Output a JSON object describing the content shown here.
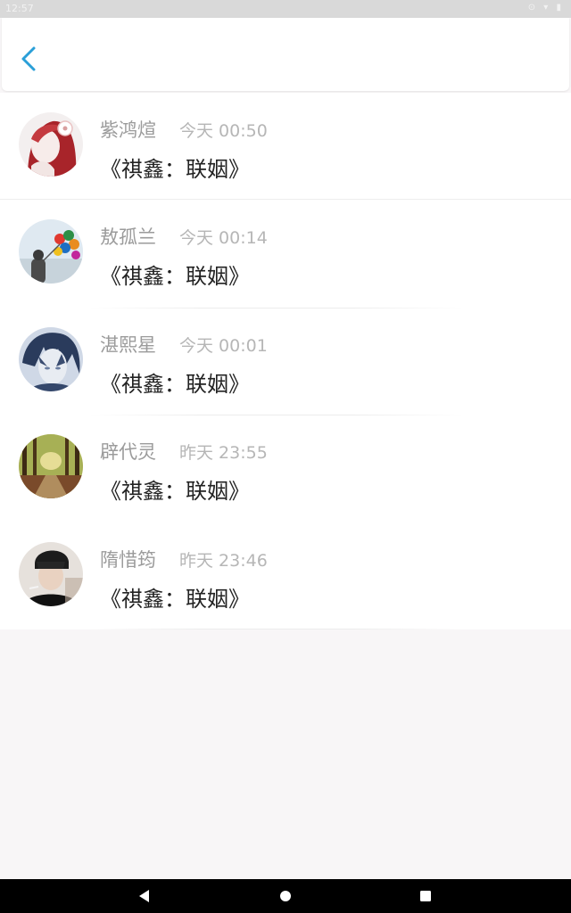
{
  "status_bar": {
    "time": "12:57",
    "icons": "⊙ ▾ ▮"
  },
  "header": {
    "back_icon": "chevron-left-icon"
  },
  "messages": [
    {
      "name": "紫鸿煊",
      "time": "今天 00:50",
      "text": "《祺鑫：联姻》"
    },
    {
      "name": "敖孤兰",
      "time": "今天 00:14",
      "text": "《祺鑫：联姻》"
    },
    {
      "name": "湛熙星",
      "time": "今天 00:01",
      "text": "《祺鑫：联姻》"
    },
    {
      "name": "辟代灵",
      "time": "昨天 23:55",
      "text": "《祺鑫：联姻》"
    },
    {
      "name": "隋惜筠",
      "time": "昨天 23:46",
      "text": "《祺鑫：联姻》"
    }
  ],
  "nav": {
    "back": "nav-back-icon",
    "home": "nav-home-icon",
    "recents": "nav-recents-icon"
  },
  "colors": {
    "accent": "#2a9fd8",
    "name": "#9b9b9b",
    "time": "#b6b6b6",
    "text": "#222222"
  }
}
